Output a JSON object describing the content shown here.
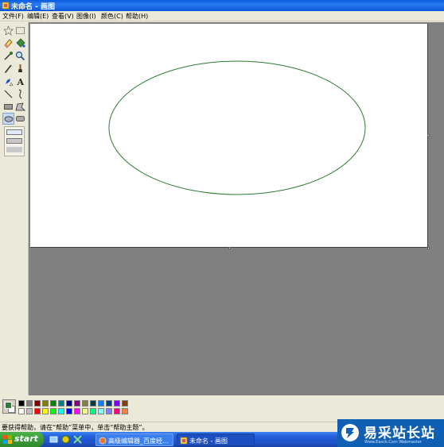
{
  "window": {
    "title": "未命名 - 画图"
  },
  "menu": [
    "文件(F)",
    "编辑(E)",
    "查看(V)",
    "图像(I)",
    "颜色(C)",
    "帮助(H)"
  ],
  "tools": [
    {
      "name": "free-form-select",
      "icon": "star-select-icon"
    },
    {
      "name": "rect-select",
      "icon": "rect-select-icon"
    },
    {
      "name": "eraser",
      "icon": "eraser-icon"
    },
    {
      "name": "fill",
      "icon": "paint-bucket-icon"
    },
    {
      "name": "pick-color",
      "icon": "eyedropper-icon"
    },
    {
      "name": "magnifier",
      "icon": "magnifier-icon"
    },
    {
      "name": "pencil",
      "icon": "pencil-icon"
    },
    {
      "name": "brush",
      "icon": "brush-icon"
    },
    {
      "name": "airbrush",
      "icon": "airbrush-icon"
    },
    {
      "name": "text",
      "icon": "text-icon",
      "glyph": "A"
    },
    {
      "name": "line",
      "icon": "line-icon"
    },
    {
      "name": "curve",
      "icon": "curve-icon"
    },
    {
      "name": "rectangle",
      "icon": "rectangle-icon"
    },
    {
      "name": "polygon",
      "icon": "polygon-icon"
    },
    {
      "name": "ellipse",
      "icon": "ellipse-icon",
      "active": true
    },
    {
      "name": "rounded-rectangle",
      "icon": "rounded-rectangle-icon"
    }
  ],
  "drawing": {
    "ellipse_color": "#2e7d32"
  },
  "palette": {
    "foreground": "#2e7d32",
    "background": "#ffffff",
    "top_row": [
      "#000000",
      "#808080",
      "#800000",
      "#808000",
      "#008000",
      "#008080",
      "#000080",
      "#800080",
      "#808040",
      "#004040",
      "#0080ff",
      "#004080",
      "#8000ff",
      "#804000"
    ],
    "bottom_row": [
      "#ffffff",
      "#c0c0c0",
      "#ff0000",
      "#ffff00",
      "#00ff00",
      "#00ffff",
      "#0000ff",
      "#ff00ff",
      "#ffff80",
      "#00ff80",
      "#80ffff",
      "#8080ff",
      "#ff0080",
      "#ff8040"
    ]
  },
  "status": {
    "text": "要获得帮助，请在“帮助”菜单中，单击“帮助主题”。"
  },
  "taskbar": {
    "start_label": "start",
    "tasks": [
      {
        "label": "高级编辑器_百度经..."
      },
      {
        "label": "未命名 - 画图"
      }
    ]
  },
  "watermark": {
    "text": "易采站长站",
    "url": "Www.Easck.Com  Webmaster"
  }
}
